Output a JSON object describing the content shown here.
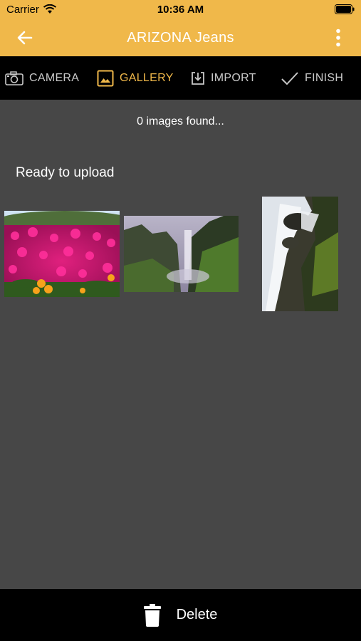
{
  "status_bar": {
    "carrier": "Carrier",
    "time": "10:36 AM"
  },
  "app_bar": {
    "title": "ARIZONA Jeans"
  },
  "tabs": [
    {
      "label": "CAMERA",
      "icon": "camera-icon",
      "active": false
    },
    {
      "label": "GALLERY",
      "icon": "gallery-icon",
      "active": true
    },
    {
      "label": "IMPORT",
      "icon": "import-icon",
      "active": false
    },
    {
      "label": "FINISH",
      "icon": "check-icon",
      "active": false
    }
  ],
  "main": {
    "found_text": "0 images found...",
    "ready_text": "Ready to upload",
    "images": [
      {
        "name": "flower-field-photo"
      },
      {
        "name": "waterfall-valley-photo"
      },
      {
        "name": "waterfall-rocks-photo"
      }
    ]
  },
  "bottom_bar": {
    "delete_label": "Delete"
  },
  "colors": {
    "accent": "#f0b84a",
    "background": "#474747",
    "bar": "#000000"
  }
}
